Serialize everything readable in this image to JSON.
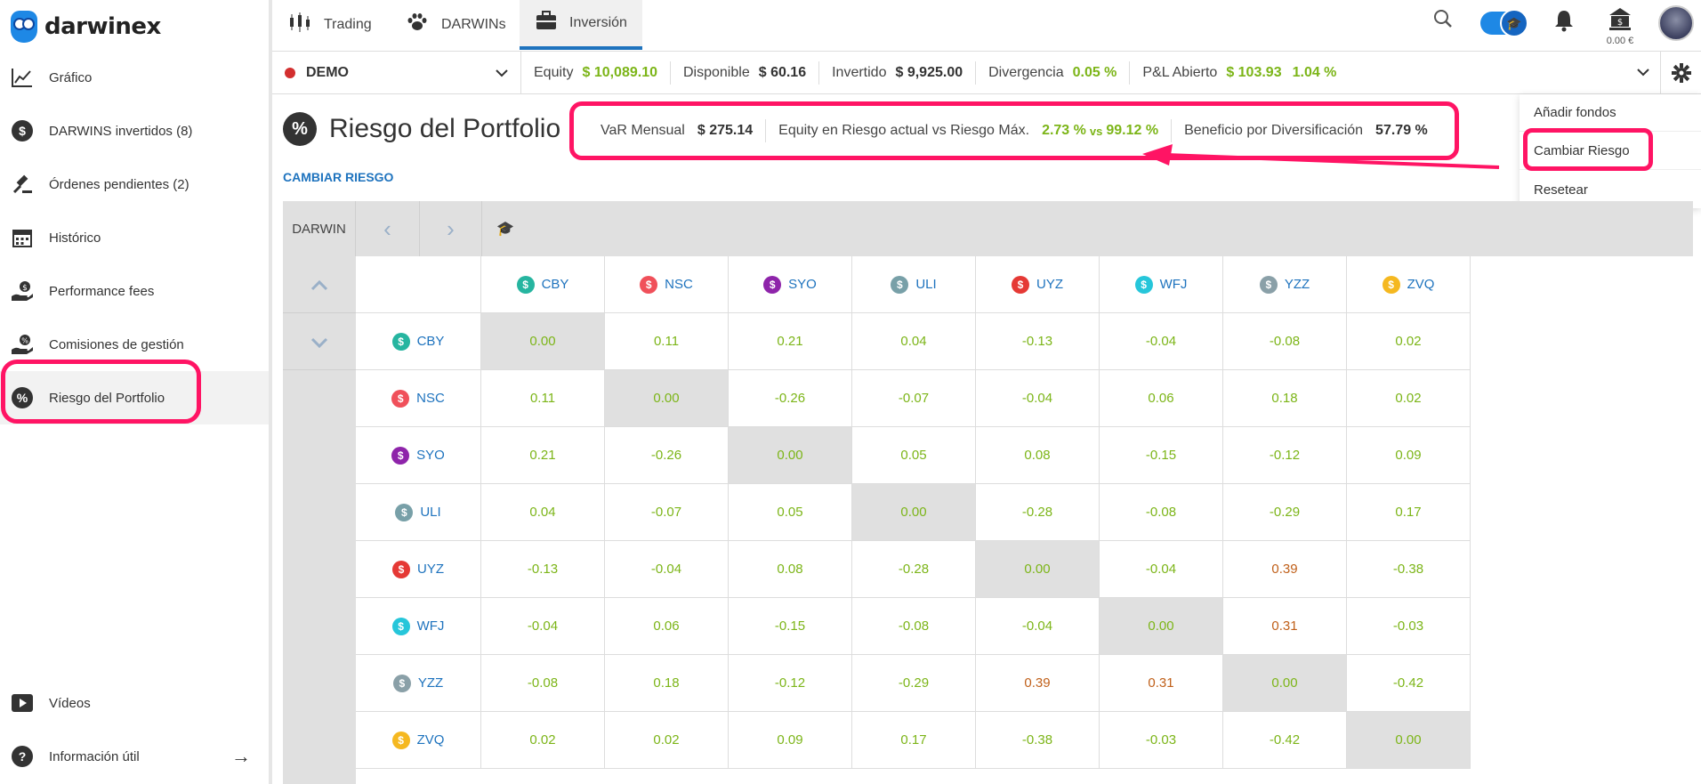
{
  "brand": "darwinex",
  "sidebar": {
    "items": [
      {
        "label": "Gráfico",
        "icon": "line-chart-icon"
      },
      {
        "label": "DARWINS invertidos (8)",
        "icon": "dollar-coin-icon"
      },
      {
        "label": "Órdenes pendientes (2)",
        "icon": "gavel-icon"
      },
      {
        "label": "Histórico",
        "icon": "calendar-icon"
      },
      {
        "label": "Performance fees",
        "icon": "hand-coin-icon"
      },
      {
        "label": "Comisiones de gestión",
        "icon": "hand-percent-icon"
      },
      {
        "label": "Riesgo del Portfolio",
        "icon": "percent-icon"
      }
    ],
    "bottom": [
      {
        "label": "Vídeos",
        "icon": "video-icon"
      },
      {
        "label": "Información útil",
        "icon": "help-icon"
      }
    ]
  },
  "nav": {
    "tabs": [
      {
        "label": "Trading",
        "icon": "candles-icon"
      },
      {
        "label": "DARWINs",
        "icon": "paw-icon"
      },
      {
        "label": "Inversión",
        "icon": "briefcase-icon"
      }
    ],
    "balance": "0.00 €"
  },
  "account": {
    "name": "DEMO",
    "stats": [
      {
        "label": "Equity",
        "value": "$ 10,089.10",
        "color": "green"
      },
      {
        "label": "Disponible",
        "value": "$ 60.16",
        "color": "dark"
      },
      {
        "label": "Invertido",
        "value": "$ 9,925.00",
        "color": "dark"
      },
      {
        "label": "Divergencia",
        "value": "0.05 %",
        "color": "green"
      },
      {
        "label": "P&L Abierto",
        "value": "$ 103.93",
        "color": "green",
        "value2": "1.04 %"
      }
    ]
  },
  "page": {
    "title": "Riesgo del Portfolio",
    "change_risk": "CAMBIAR RIESGO"
  },
  "risk": {
    "var_label": "VaR Mensual",
    "var_value": "$ 275.14",
    "equity_label": "Equity en Riesgo actual vs Riesgo Máx.",
    "equity_current": "2.73 %",
    "vs": "vs",
    "equity_max": "99.12 %",
    "div_label": "Beneficio por Diversificación",
    "div_value": "57.79 %"
  },
  "menu": {
    "items": [
      "Añadir fondos",
      "Cambiar Riesgo",
      "Resetear"
    ]
  },
  "table": {
    "header_label": "DARWIN",
    "darwins": [
      {
        "name": "CBY",
        "color": "#26b5a0"
      },
      {
        "name": "NSC",
        "color": "#f0505a"
      },
      {
        "name": "SYO",
        "color": "#8e24aa"
      },
      {
        "name": "ULI",
        "color": "#78a0a8"
      },
      {
        "name": "UYZ",
        "color": "#e53935"
      },
      {
        "name": "WFJ",
        "color": "#26c6da"
      },
      {
        "name": "YZZ",
        "color": "#8aa0a8"
      },
      {
        "name": "ZVQ",
        "color": "#f5b820"
      }
    ],
    "matrix": [
      [
        "0.00",
        "0.11",
        "0.21",
        "0.04",
        "-0.13",
        "-0.04",
        "-0.08",
        "0.02"
      ],
      [
        "0.11",
        "0.00",
        "-0.26",
        "-0.07",
        "-0.04",
        "0.06",
        "0.18",
        "0.02"
      ],
      [
        "0.21",
        "-0.26",
        "0.00",
        "0.05",
        "0.08",
        "-0.15",
        "-0.12",
        "0.09"
      ],
      [
        "0.04",
        "-0.07",
        "0.05",
        "0.00",
        "-0.28",
        "-0.08",
        "-0.29",
        "0.17"
      ],
      [
        "-0.13",
        "-0.04",
        "0.08",
        "-0.28",
        "0.00",
        "-0.04",
        "0.39",
        "-0.38"
      ],
      [
        "-0.04",
        "0.06",
        "-0.15",
        "-0.08",
        "-0.04",
        "0.00",
        "0.31",
        "-0.03"
      ],
      [
        "-0.08",
        "0.18",
        "-0.12",
        "-0.29",
        "0.39",
        "0.31",
        "0.00",
        "-0.42"
      ],
      [
        "0.02",
        "0.02",
        "0.09",
        "0.17",
        "-0.38",
        "-0.03",
        "-0.42",
        "0.00"
      ]
    ]
  },
  "colors": {
    "accent": "#1e73be",
    "highlight": "#ff1464",
    "green": "#7cb518",
    "warn": "#c0601a"
  }
}
